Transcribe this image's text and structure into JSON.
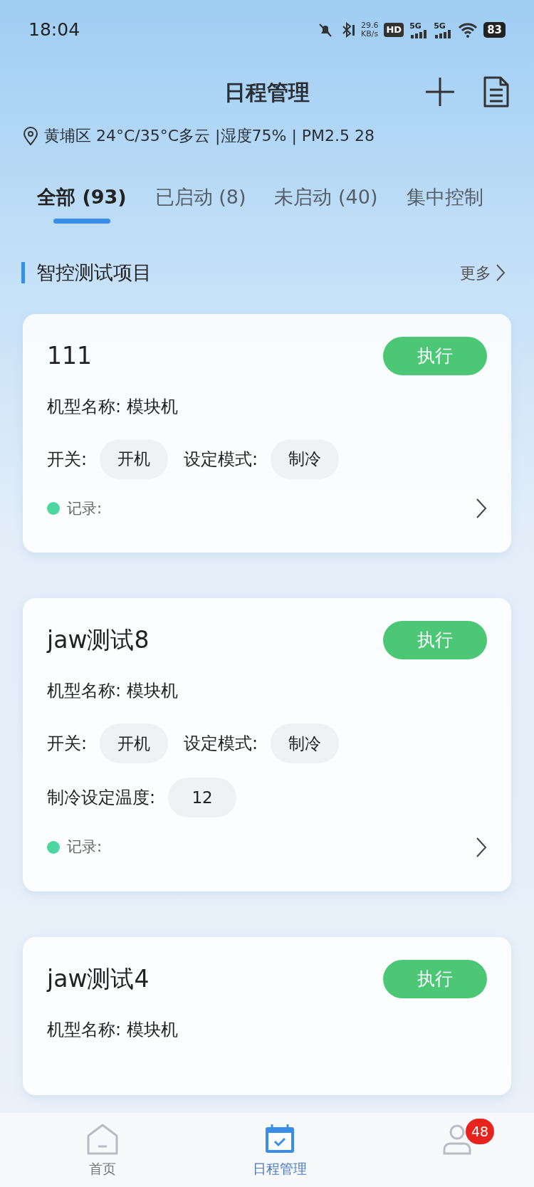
{
  "status_bar": {
    "time": "18:04",
    "net_speed": "29.6",
    "net_unit": "KB/s",
    "hd": "HD",
    "sim_labels": [
      "5G",
      "5G"
    ],
    "battery": "83"
  },
  "header": {
    "title": "日程管理",
    "weather": "黄埔区 24°C/35°C多云 |湿度75% | PM2.5 28"
  },
  "tabs": [
    {
      "label": "全部 (93)",
      "selected": true
    },
    {
      "label": "已启动 (8)",
      "selected": false
    },
    {
      "label": "未启动 (40)",
      "selected": false
    },
    {
      "label": "集中控制",
      "selected": false
    }
  ],
  "section": {
    "title": "智控测试项目",
    "more": "更多"
  },
  "cards": [
    {
      "title": "111",
      "action": "执行",
      "model": "机型名称: 模块机",
      "rows": [
        [
          {
            "label": "开关:",
            "value": "开机"
          },
          {
            "label": "设定模式:",
            "value": "制冷"
          }
        ]
      ],
      "record": {
        "label": "记录:",
        "color": "#4cd6a0"
      }
    },
    {
      "title": "jaw测试8",
      "action": "执行",
      "model": "机型名称: 模块机",
      "rows": [
        [
          {
            "label": "开关:",
            "value": "开机"
          },
          {
            "label": "设定模式:",
            "value": "制冷"
          }
        ],
        [
          {
            "label": "制冷设定温度:",
            "value": "12"
          }
        ]
      ],
      "record": {
        "label": "记录:",
        "color": "#4cd6a0"
      }
    },
    {
      "title": "jaw测试4",
      "action": "执行",
      "model": "机型名称: 模块机"
    }
  ],
  "bottom_nav": [
    {
      "kind": "home",
      "label": "首页",
      "selected": false
    },
    {
      "kind": "calendar",
      "label": "日程管理",
      "selected": true
    },
    {
      "kind": "person",
      "badge": "48",
      "selected": false
    }
  ]
}
